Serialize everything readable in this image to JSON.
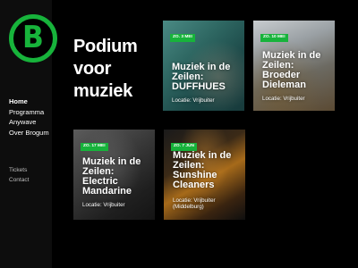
{
  "brand": {
    "logo_letter": "B",
    "accent_color": "#17b33b"
  },
  "nav": {
    "primary": [
      "Home",
      "Programma",
      "Anywave",
      "Over Brogum"
    ],
    "secondary": [
      "Tickets",
      "Contact"
    ]
  },
  "heading": {
    "line1": "Podium",
    "line2": "voor",
    "line3": "muziek"
  },
  "cards": [
    {
      "date": "ZO. 3 MEI",
      "title_lines": [
        "Muziek in de",
        "Zeilen:",
        "DUFFHUES"
      ],
      "location_lines": [
        "Locatie: Vrijbuiter"
      ]
    },
    {
      "date": "ZO. 10 MEI",
      "title_lines": [
        "Muziek in de",
        "Zeilen:",
        "Broeder",
        "Dieleman"
      ],
      "location_lines": [
        "Locatie: Vrijbuiter"
      ]
    },
    {
      "date": "ZO. 17 MEI",
      "title_lines": [
        "Muziek in de",
        "Zeilen:",
        "Electric",
        "Mandarine"
      ],
      "location_lines": [
        "Locatie: Vrijbuiter"
      ]
    },
    {
      "date": "ZO. 7 JUN",
      "title_lines": [
        "Muziek in de",
        "Zeilen:",
        "Sunshine",
        "Cleaners"
      ],
      "location_lines": [
        "Locatie: Vrijbuiter",
        "(Middelburg)"
      ]
    }
  ]
}
